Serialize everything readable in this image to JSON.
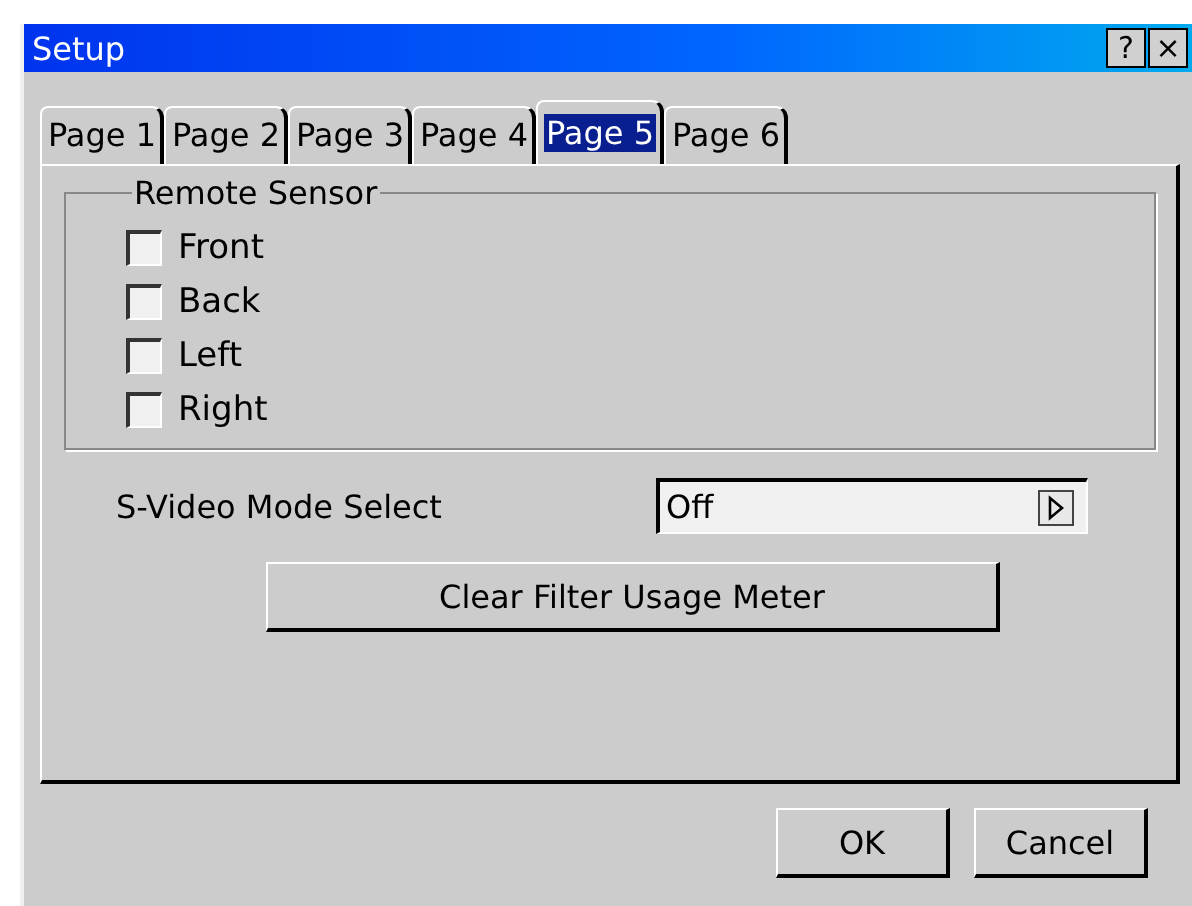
{
  "window": {
    "title": "Setup",
    "help_button": "?",
    "close_button": "×"
  },
  "tabs": [
    {
      "label": "Page 1",
      "selected": false
    },
    {
      "label": "Page 2",
      "selected": false
    },
    {
      "label": "Page 3",
      "selected": false
    },
    {
      "label": "Page 4",
      "selected": false
    },
    {
      "label": "Page 5",
      "selected": true
    },
    {
      "label": "Page 6",
      "selected": false
    }
  ],
  "remote_sensor": {
    "title": "Remote Sensor",
    "options": [
      {
        "label": "Front",
        "checked": false
      },
      {
        "label": "Back",
        "checked": false
      },
      {
        "label": "Left",
        "checked": false
      },
      {
        "label": "Right",
        "checked": false
      }
    ]
  },
  "s_video_mode": {
    "label": "S-Video Mode Select",
    "value": "Off"
  },
  "clear_button": "Clear Filter Usage Meter",
  "buttons": [
    "OK",
    "Cancel"
  ]
}
